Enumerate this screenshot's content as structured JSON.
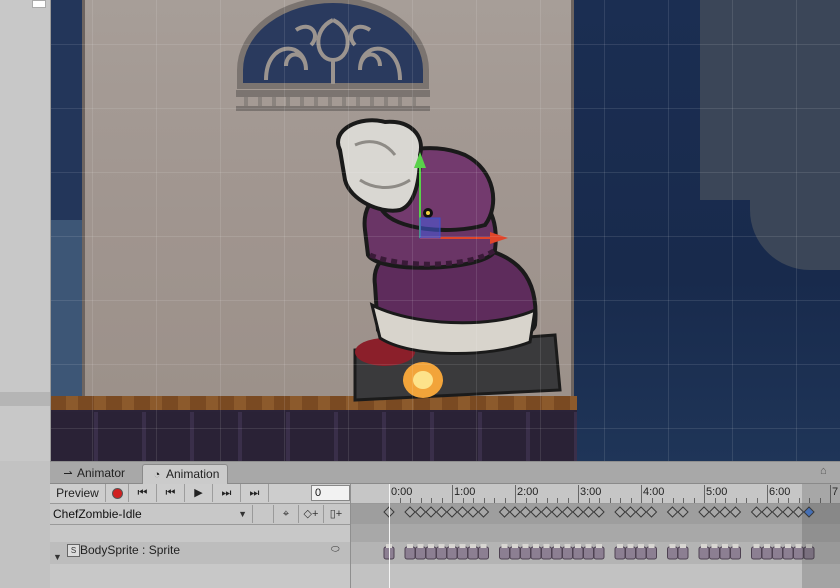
{
  "tabs": {
    "animator_label": "Animator",
    "animation_label": "Animation"
  },
  "toolbar": {
    "preview_label": "Preview",
    "frame_value": "0"
  },
  "clip": {
    "name": "ChefZombie-Idle"
  },
  "property": {
    "label": "BodySprite : Sprite"
  },
  "timeline": {
    "time_labels": [
      "0:00",
      "1:00",
      "2:00",
      "3:00",
      "4:00",
      "5:00",
      "6:00",
      "7"
    ],
    "summary_keyframes": [
      "0:00",
      "0:20",
      "0:30",
      "0:40",
      "0:50",
      "1:00",
      "1:10",
      "1:20",
      "1:30",
      "1:50",
      "2:00",
      "2:10",
      "2:20",
      "2:30",
      "2:40",
      "2:50",
      "3:00",
      "3:10",
      "3:20",
      "3:40",
      "3:50",
      "4:00",
      "4:10",
      "4:30",
      "4:40",
      "5:00",
      "5:10",
      "5:20",
      "5:30",
      "5:50",
      "6:00",
      "6:10",
      "6:20",
      "6:30",
      "6:40"
    ],
    "selected_keyframe": "6:40"
  },
  "colors": {
    "record": "#d02020",
    "selected_key": "#4a7fd8",
    "key": "#3a3a3a"
  },
  "icons": {
    "animator_tab": "animator-icon",
    "animation_tab": "clock-icon",
    "lock": "lock-icon",
    "record": "record-icon",
    "play": "play-icon"
  }
}
